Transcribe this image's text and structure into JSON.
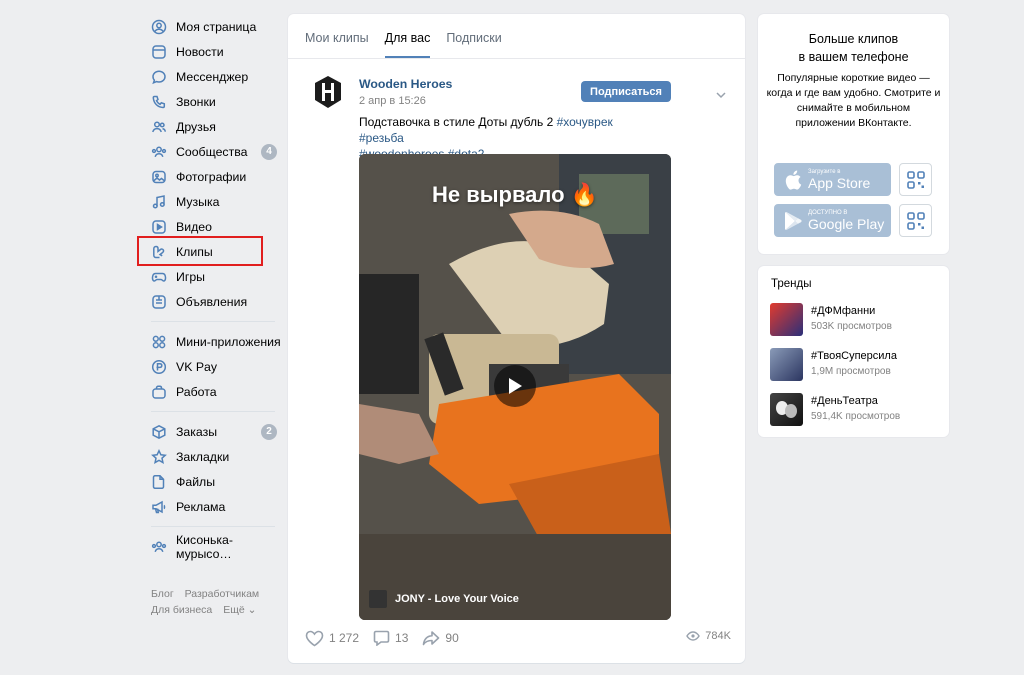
{
  "sidebar": {
    "items": [
      {
        "label": "Моя страница",
        "icon": "user-circle-icon"
      },
      {
        "label": "Новости",
        "icon": "news-icon"
      },
      {
        "label": "Мессенджер",
        "icon": "message-icon"
      },
      {
        "label": "Звонки",
        "icon": "phone-icon"
      },
      {
        "label": "Друзья",
        "icon": "friends-icon"
      },
      {
        "label": "Сообщества",
        "icon": "communities-icon",
        "badge": "4"
      },
      {
        "label": "Фотографии",
        "icon": "photo-icon"
      },
      {
        "label": "Музыка",
        "icon": "music-icon"
      },
      {
        "label": "Видео",
        "icon": "video-icon"
      },
      {
        "label": "Клипы",
        "icon": "clips-icon"
      },
      {
        "label": "Игры",
        "icon": "gamepad-icon"
      },
      {
        "label": "Объявления",
        "icon": "classifieds-icon"
      }
    ],
    "items2": [
      {
        "label": "Мини-приложения",
        "icon": "apps-icon"
      },
      {
        "label": "VK Pay",
        "icon": "vkpay-icon"
      },
      {
        "label": "Работа",
        "icon": "briefcase-icon"
      }
    ],
    "items3": [
      {
        "label": "Заказы",
        "icon": "box-icon",
        "badge": "2"
      },
      {
        "label": "Закладки",
        "icon": "star-icon"
      },
      {
        "label": "Файлы",
        "icon": "file-icon"
      },
      {
        "label": "Реклама",
        "icon": "megaphone-icon"
      }
    ],
    "items4": [
      {
        "label": "Кисонька-мурысо…",
        "icon": "group-icon"
      }
    ],
    "footer": {
      "blog": "Блог",
      "devs": "Разработчикам",
      "business": "Для бизнеса",
      "more": "Ещё ⌄"
    }
  },
  "main": {
    "tabs": [
      "Мои клипы",
      "Для вас",
      "Подписки"
    ],
    "active_tab": 1,
    "post": {
      "author": "Wooden Heroes",
      "date": "2 апр в 15:26",
      "subscribe_label": "Подписаться",
      "text_plain": "Подставочка в стиле Доты дубль 2 ",
      "tags_line1": "#хочуврек #резьба",
      "tags_line2": "#woodenheroes #dota2",
      "video_overlay": "Не вырвало 🔥",
      "music_track": "JONY - Love Your Voice",
      "likes": "1 272",
      "comments": "13",
      "shares": "90",
      "views": "784K"
    }
  },
  "promo": {
    "title_line1": "Больше клипов",
    "title_line2": "в вашем телефоне",
    "text": "Популярные короткие видео — когда и где вам удобно. Смотрите и снимайте в мобильном приложении ВКонтакте.",
    "appstore_small": "Загрузите в",
    "appstore_big": "App Store",
    "googleplay_small": "ДОСТУПНО В",
    "googleplay_big": "Google Play"
  },
  "trends": {
    "title": "Тренды",
    "items": [
      {
        "name": "#ДФМфанни",
        "views": "503K просмотров",
        "color": "#c0392b"
      },
      {
        "name": "#ТвояСуперсила",
        "views": "1,9M просмотров",
        "color": "#3b4a8a"
      },
      {
        "name": "#ДеньТеатра",
        "views": "591,4K просмотров",
        "color": "#2b2b2b"
      }
    ]
  },
  "colors": {
    "accent": "#5181b8",
    "link": "#2a5885",
    "highlight": "#e11e1e"
  }
}
